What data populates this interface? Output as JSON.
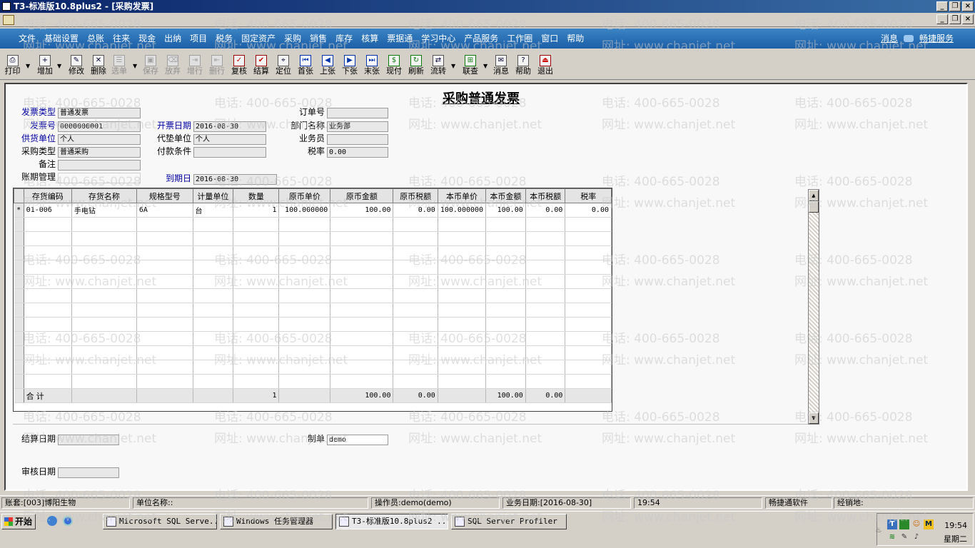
{
  "window": {
    "title": "T3-标准版10.8plus2 - [采购发票]"
  },
  "menu": {
    "items": [
      "文件",
      "基础设置",
      "总账",
      "往来",
      "现金",
      "出纳",
      "项目",
      "税务",
      "固定资产",
      "采购",
      "销售",
      "库存",
      "核算",
      "票据通",
      "学习中心",
      "产品服务",
      "工作圈",
      "窗口",
      "帮助"
    ],
    "message": "消息",
    "service": "畅捷服务"
  },
  "toolbar": {
    "buttons": [
      {
        "label": "打印",
        "icon": "print-icon",
        "enabled": true
      },
      {
        "label": "增加",
        "icon": "add-icon",
        "enabled": true
      },
      {
        "label": "修改",
        "icon": "edit-icon",
        "enabled": true
      },
      {
        "label": "删除",
        "icon": "delete-icon",
        "enabled": true
      },
      {
        "label": "选单",
        "icon": "select-order-icon",
        "enabled": false
      },
      {
        "label": "保存",
        "icon": "save-icon",
        "enabled": false
      },
      {
        "label": "放弃",
        "icon": "discard-icon",
        "enabled": false
      },
      {
        "label": "增行",
        "icon": "add-row-icon",
        "enabled": false
      },
      {
        "label": "删行",
        "icon": "delete-row-icon",
        "enabled": false
      },
      {
        "label": "复核",
        "icon": "review-icon",
        "enabled": true
      },
      {
        "label": "结算",
        "icon": "settle-icon",
        "enabled": true
      },
      {
        "label": "定位",
        "icon": "locate-icon",
        "enabled": true
      },
      {
        "label": "首张",
        "icon": "first-icon",
        "enabled": true
      },
      {
        "label": "上张",
        "icon": "prev-icon",
        "enabled": true
      },
      {
        "label": "下张",
        "icon": "next-icon",
        "enabled": true
      },
      {
        "label": "末张",
        "icon": "last-icon",
        "enabled": true
      },
      {
        "label": "现付",
        "icon": "cash-pay-icon",
        "enabled": true
      },
      {
        "label": "刷新",
        "icon": "refresh-icon",
        "enabled": true
      },
      {
        "label": "流转",
        "icon": "flow-icon",
        "enabled": true
      },
      {
        "label": "联查",
        "icon": "link-query-icon",
        "enabled": true
      },
      {
        "label": "消息",
        "icon": "message-icon",
        "enabled": true
      },
      {
        "label": "帮助",
        "icon": "help-icon",
        "enabled": true
      },
      {
        "label": "退出",
        "icon": "exit-icon",
        "enabled": true
      }
    ]
  },
  "form": {
    "title": "采购普通发票",
    "invoice_type": {
      "label": "发票类型",
      "value": "普通发票"
    },
    "invoice_no": {
      "label": "发票号",
      "value": "0000000001"
    },
    "supplier": {
      "label": "供货单位",
      "value": "个人"
    },
    "purchase_type": {
      "label": "采购类型",
      "value": "普通采购"
    },
    "remark": {
      "label": "备注",
      "value": ""
    },
    "account_period": {
      "label": "账期管理"
    },
    "invoice_date": {
      "label": "开票日期",
      "value": "2016-08-30"
    },
    "agent": {
      "label": "代垫单位",
      "value": "个人"
    },
    "payment_terms": {
      "label": "付款条件",
      "value": ""
    },
    "due_date": {
      "label": "到期日",
      "value": "2016-08-30"
    },
    "order_no": {
      "label": "订单号",
      "value": ""
    },
    "department": {
      "label": "部门名称",
      "value": "业务部"
    },
    "salesman": {
      "label": "业务员",
      "value": ""
    },
    "tax_rate": {
      "label": "税率",
      "value": "0.00"
    },
    "settle_date": {
      "label": "结算日期",
      "value": ""
    },
    "maker": {
      "label": "制单",
      "value": "demo"
    },
    "audit_date": {
      "label": "审核日期",
      "value": ""
    }
  },
  "grid": {
    "columns": [
      "存货编码",
      "存货名称",
      "规格型号",
      "计量单位",
      "数量",
      "原币单价",
      "原币金额",
      "原币税额",
      "本币单价",
      "本币金额",
      "本币税额",
      "税率"
    ],
    "rows": [
      {
        "marker": "*",
        "cells": [
          "01-006",
          "手电钻",
          "6A",
          "台",
          "1",
          "100.000000",
          "100.00",
          "0.00",
          "100.000000",
          "100.00",
          "0.00",
          "0.00"
        ]
      }
    ],
    "total": {
      "label": "合  计",
      "cells": [
        "",
        "",
        "",
        "",
        "1",
        "",
        "100.00",
        "0.00",
        "",
        "100.00",
        "0.00",
        ""
      ]
    }
  },
  "watermark": {
    "phone": "电话: 400-665-0028",
    "site": "网址: www.chanjet.net"
  },
  "statusbar": {
    "account": "账套:[003]博阳生物",
    "company": "单位名称::",
    "operator": "操作员:demo(demo)",
    "business_date": "业务日期:[2016-08-30]",
    "time": "19:54",
    "vendor": "畅捷通软件",
    "dealer": "经销地:"
  },
  "taskbar": {
    "start": "开始",
    "tasks": [
      "Microsoft SQL Serve...",
      "Windows 任务管理器",
      "T3-标准版10.8plus2 ...",
      "SQL Server Profiler"
    ],
    "clock_time": "19:54",
    "clock_day": "星期二"
  }
}
